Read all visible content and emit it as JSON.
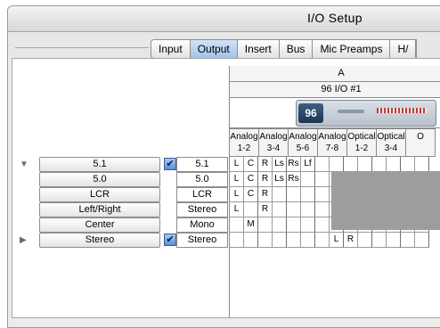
{
  "window": {
    "title": "I/O Setup"
  },
  "tabs": [
    {
      "label": "Input",
      "active": false
    },
    {
      "label": "Output",
      "active": true
    },
    {
      "label": "Insert",
      "active": false
    },
    {
      "label": "Bus",
      "active": false
    },
    {
      "label": "Mic Preamps",
      "active": false
    },
    {
      "label": "H/",
      "active": false
    }
  ],
  "grid": {
    "group_label": "A",
    "device_label": "96 I/O #1",
    "device_badge": "96",
    "ports": [
      {
        "label": "Analog\n1-2"
      },
      {
        "label": "Analog\n3-4"
      },
      {
        "label": "Analog\n5-6"
      },
      {
        "label": "Analog\n7-8"
      },
      {
        "label": "Optical\n1-2"
      },
      {
        "label": "Optical\n3-4"
      },
      {
        "label": "O"
      }
    ]
  },
  "paths": [
    {
      "name": "5.1",
      "format": "5.1",
      "expander": "down",
      "checked": true,
      "cells": [
        "L",
        "C",
        "R",
        "Ls",
        "Rs",
        "Lf",
        "",
        "",
        "",
        "",
        "",
        "",
        "",
        ""
      ]
    },
    {
      "name": "5.0",
      "format": "5.0",
      "expander": "",
      "checked": false,
      "cells": [
        "L",
        "C",
        "R",
        "Ls",
        "Rs",
        "",
        "",
        "",
        "",
        "",
        "",
        "",
        "",
        ""
      ]
    },
    {
      "name": "LCR",
      "format": "LCR",
      "expander": "",
      "checked": false,
      "cells": [
        "L",
        "C",
        "R",
        "",
        "",
        "",
        "",
        "",
        "",
        "",
        "",
        "",
        "",
        ""
      ]
    },
    {
      "name": "Left/Right",
      "format": "Stereo",
      "expander": "",
      "checked": false,
      "cells": [
        "L",
        "",
        "R",
        "",
        "",
        "",
        "",
        "",
        "",
        "",
        "",
        "",
        "",
        ""
      ]
    },
    {
      "name": "Center",
      "format": "Mono",
      "expander": "",
      "checked": false,
      "cells": [
        "",
        "M",
        "",
        "",
        "",
        "",
        "",
        "",
        "",
        "",
        "",
        "",
        "",
        ""
      ]
    },
    {
      "name": "Stereo",
      "format": "Stereo",
      "expander": "right",
      "checked": true,
      "cells": [
        "",
        "",
        "",
        "",
        "",
        "",
        "",
        "L",
        "R",
        "",
        "",
        "",
        "",
        ""
      ]
    }
  ],
  "icons": {
    "expanded": "triangle-down-icon",
    "collapsed": "triangle-right-icon",
    "checkbox": "checkmark-icon"
  },
  "colors": {
    "selected_tab": "#9ec4ea",
    "unassigned_region": "#9d9d9d"
  }
}
